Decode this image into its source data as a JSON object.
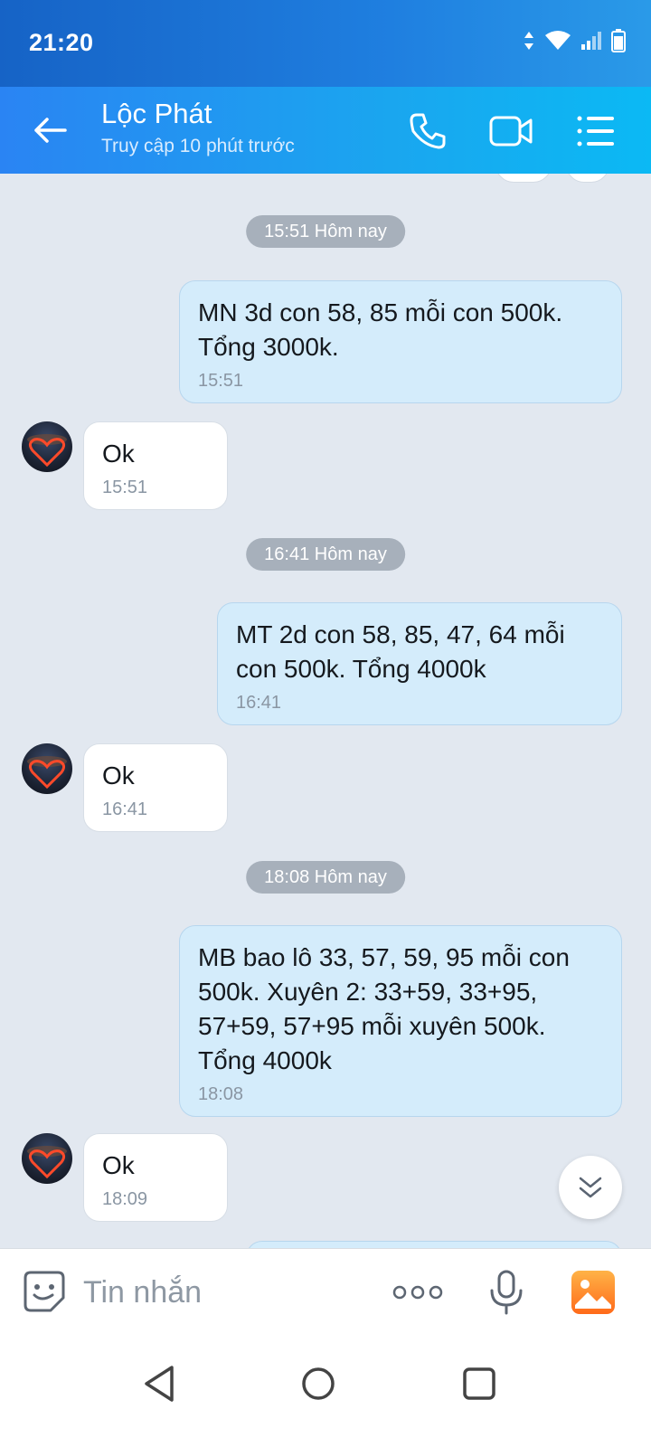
{
  "status_bar": {
    "time": "21:20"
  },
  "header": {
    "name": "Lộc Phát",
    "status": "Truy cập 10 phút trước"
  },
  "messages": [
    {
      "type": "divider",
      "text": "15:51 Hôm nay"
    },
    {
      "type": "outgoing",
      "lines": [
        "MN 3d con 58, 85 mỗi con 500k.",
        "Tổng 3000k."
      ],
      "time": "15:51"
    },
    {
      "type": "incoming",
      "lines": [
        "Ok"
      ],
      "time": "15:51"
    },
    {
      "type": "divider",
      "text": "16:41 Hôm nay"
    },
    {
      "type": "outgoing",
      "lines": [
        "MT 2d con 58, 85, 47, 64 mỗi",
        "con 500k. Tổng 4000k"
      ],
      "time": "16:41"
    },
    {
      "type": "incoming",
      "lines": [
        "Ok"
      ],
      "time": "16:41"
    },
    {
      "type": "divider",
      "text": "18:08 Hôm nay"
    },
    {
      "type": "outgoing",
      "lines": [
        "MB bao lô 33, 57, 59, 95 mỗi con",
        "500k. Xuyên 2: 33+59, 33+95,",
        "57+59, 57+95 mỗi xuyên 500k.",
        "Tổng 4000k"
      ],
      "time": "18:08"
    },
    {
      "type": "incoming",
      "lines": [
        "Ok"
      ],
      "time": "18:09"
    }
  ],
  "input": {
    "placeholder": "Tin nhắn"
  },
  "colors": {
    "header_start": "#2a84f3",
    "header_end": "#0bb9f4",
    "outgoing_bubble": "#d4ecfb",
    "incoming_bubble": "#ffffff",
    "chat_background": "#e2e8f0"
  },
  "icons": {
    "back": "arrow-left-icon",
    "call": "phone-icon",
    "video": "video-camera-icon",
    "menu": "list-menu-icon",
    "sticker": "smiley-sticker-icon",
    "more": "more-dots-icon",
    "mic": "microphone-icon",
    "image": "image-gallery-icon",
    "scroll": "double-chevron-down-icon"
  }
}
